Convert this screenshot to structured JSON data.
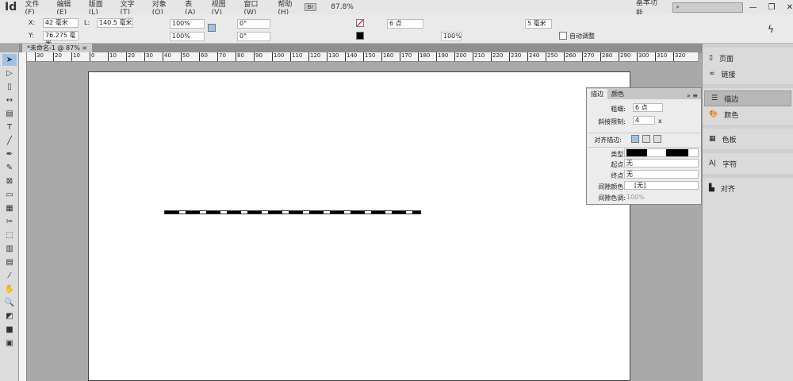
{
  "app": {
    "logo": "Id",
    "menus": [
      "文件(F)",
      "编辑(E)",
      "版面(L)",
      "文字(T)",
      "对象(O)",
      "表(A)",
      "视图(V)",
      "窗口(W)",
      "帮助(H)"
    ],
    "bridge": "Br",
    "zoom": "87.8%",
    "workspace": "基本功能",
    "search_placeholder": ""
  },
  "control": {
    "x_label": "X:",
    "x": "42 毫米",
    "y_label": "Y:",
    "y": "76.275 毫米",
    "l_label": "L:",
    "l": "140.5 毫米",
    "scale_x": "100%",
    "scale_y": "100%",
    "rotate": "0°",
    "shear": "0°",
    "stroke_weight": "6 点",
    "opacity": "100%",
    "corner": "5 毫米",
    "auto_fit": "自动调整"
  },
  "document": {
    "tab": "*未命名-1 @ 87%",
    "close": "×"
  },
  "ruler": {
    "labels": [
      "30",
      "20",
      "10",
      "0",
      "10",
      "20",
      "30",
      "40",
      "50",
      "60",
      "70",
      "80",
      "90",
      "100",
      "110",
      "120",
      "130",
      "140",
      "150",
      "160",
      "170",
      "180",
      "190",
      "200",
      "210",
      "220",
      "230",
      "240",
      "250",
      "260",
      "270",
      "280",
      "290",
      "300",
      "310",
      "320"
    ]
  },
  "stroke_panel": {
    "tabs": [
      "描边",
      "颜色"
    ],
    "weight_label": "粗细:",
    "weight": "6 点",
    "miter_label": "斜接限制:",
    "miter": "4",
    "miter_unit": "x",
    "align_label": "对齐描边:",
    "type_label": "类型:",
    "start_label": "起点:",
    "start": "无",
    "end_label": "终点:",
    "end": "无",
    "gap_color_label": "间隙颜色:",
    "gap_color": "[无]",
    "gap_tint_label": "间隙色调:",
    "gap_tint": "100%"
  },
  "dock": {
    "items": [
      "页面",
      "链接",
      "描边",
      "颜色",
      "色板",
      "字符",
      "对齐"
    ]
  }
}
